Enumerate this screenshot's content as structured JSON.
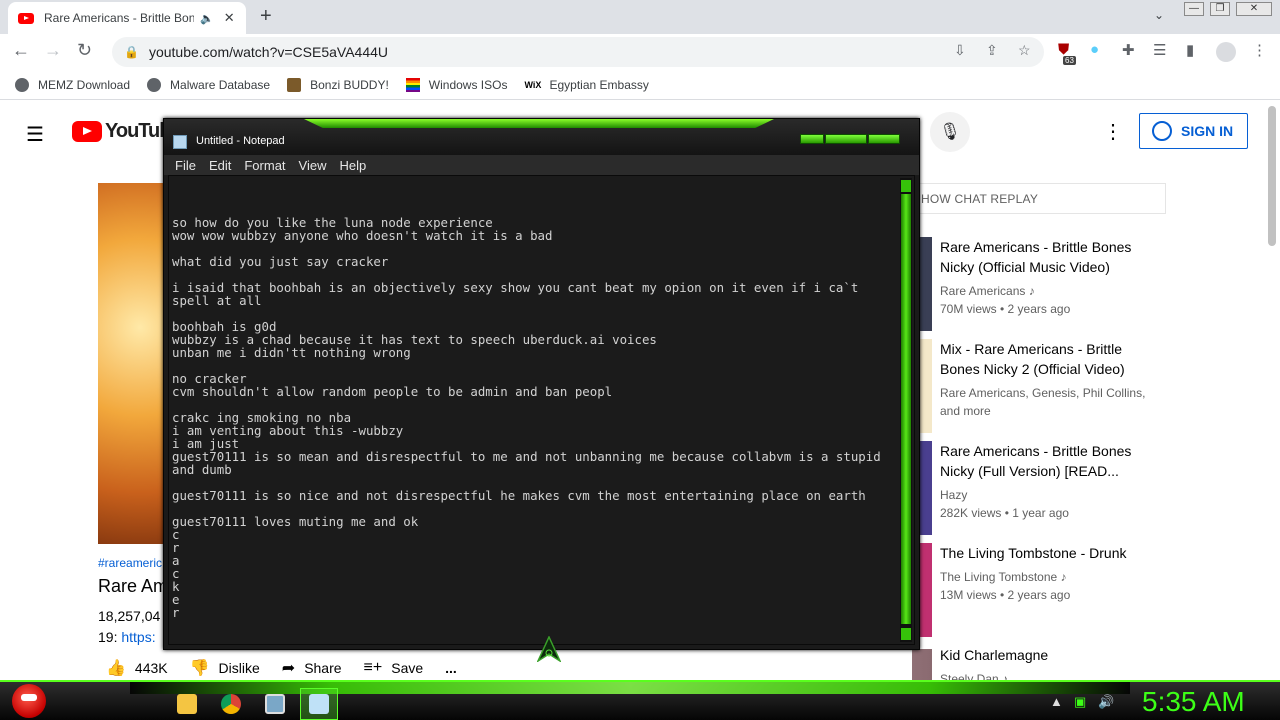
{
  "browser": {
    "tab_title": "Rare Americans - Brittle Bones Nicky (Official Music Video)",
    "new_tab_symbol": "+",
    "address": "youtube.com/watch?v=CSE5aVA444U",
    "extension_badge": "63",
    "bookmarks": [
      "MEMZ Download",
      "Malware Database",
      "Bonzi BUDDY!",
      "Windows ISOs",
      "Egyptian Embassy"
    ],
    "bookmark_icons": [
      "globe-icon",
      "globe-icon",
      "bonzi-icon",
      "pride-flag-icon",
      "wix-icon"
    ]
  },
  "youtube": {
    "logo_text": "YouTube",
    "signin_label": "SIGN IN",
    "hashtags": "#rareameric",
    "video_title": "Rare Am",
    "views": "18,257,04",
    "description_prefix": "19: ",
    "description_link": "https:",
    "actions": {
      "like_count": "443K",
      "dislike": "Dislike",
      "share": "Share",
      "save": "Save",
      "more": "..."
    },
    "chat_replay": "HOW CHAT REPLAY",
    "recommendations": [
      {
        "title": "Rare Americans - Brittle Bones Nicky (Official Music Video)",
        "channel": "Rare Americans ♪",
        "meta": "70M views • 2 years ago"
      },
      {
        "title": "Mix - Rare Americans - Brittle Bones Nicky 2 (Official Video)",
        "channel": "Rare Americans, Genesis, Phil Collins, and more",
        "meta": ""
      },
      {
        "title": "Rare Americans - Brittle Bones Nicky (Full Version) [READ...",
        "channel": "Hazy",
        "meta": "282K views • 1 year ago"
      },
      {
        "title": "The Living Tombstone - Drunk",
        "channel": "The Living Tombstone ♪",
        "meta": "13M views • 2 years ago"
      },
      {
        "title": "Kid Charlemagne",
        "channel": "Steely Dan ♪",
        "meta": ""
      }
    ]
  },
  "notepad": {
    "title": "Untitled - Notepad",
    "menu": [
      "File",
      "Edit",
      "Format",
      "View",
      "Help"
    ],
    "text": "so how do you like the luna node experience\nwow wow wubbzy anyone who doesn't watch it is a bad\n\nwhat did you just say cracker\n\ni isaid that boohbah is an objectively sexy show you cant beat my opion on it even if i ca`t spell at all\n\nboohbah is g0d\nwubbzy is a chad because it has text to speech uberduck.ai voices\nunban me i didn'tt nothing wrong\n\nno cracker\ncvm shouldn't allow random people to be admin and ban peopl\n\ncrakc ing smoking no nba\ni am venting about this -wubbzy\ni am just\nguest70111 is so mean and disrespectful to me and not unbanning me because collabvm is a stupid and dumb\n\nguest70111 is so nice and not disrespectful he makes cvm the most entertaining place on earth\n\nguest70111 loves muting me and ok\nc\nr\na\nc\nk\ne\nr"
  },
  "taskbar": {
    "clock": "5:35 AM",
    "apps": [
      "folder-icon",
      "chrome-icon",
      "monitor-icon",
      "notepad-icon"
    ]
  },
  "colors": {
    "youtube_red": "#ff0000",
    "link_blue": "#065fd4",
    "skin_green": "#3dff17",
    "notepad_bg": "#1b1b1b"
  }
}
